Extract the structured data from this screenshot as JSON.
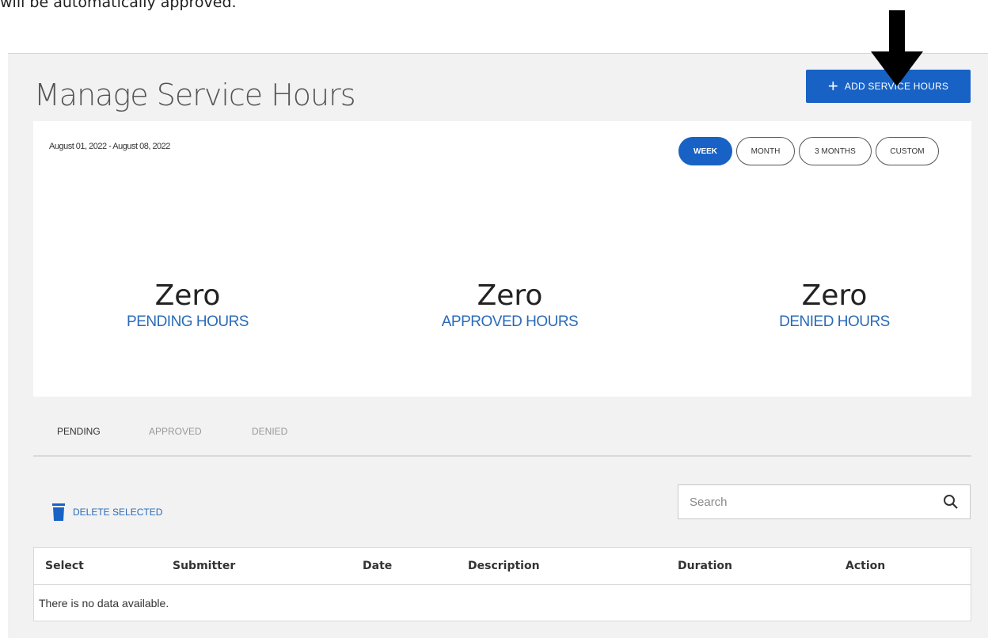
{
  "intro": {
    "text": "will be automatically approved."
  },
  "page": {
    "title": "Manage Service Hours"
  },
  "add_button": {
    "label": "ADD SERVICE HOURS",
    "icon": "plus-icon"
  },
  "summary": {
    "date_range": "August 01, 2022 - August 08, 2022",
    "range_tabs": [
      {
        "label": "WEEK",
        "active": true
      },
      {
        "label": "MONTH",
        "active": false
      },
      {
        "label": "3 MONTHS",
        "active": false
      },
      {
        "label": "CUSTOM",
        "active": false
      }
    ],
    "stats": [
      {
        "value": "Zero",
        "label": "PENDING HOURS"
      },
      {
        "value": "Zero",
        "label": "APPROVED HOURS"
      },
      {
        "value": "Zero",
        "label": "DENIED HOURS"
      }
    ]
  },
  "status_tabs": [
    {
      "label": "PENDING",
      "active": true
    },
    {
      "label": "APPROVED",
      "active": false
    },
    {
      "label": "DENIED",
      "active": false
    }
  ],
  "actions": {
    "delete_selected": "DELETE SELECTED"
  },
  "search": {
    "placeholder": "Search",
    "value": ""
  },
  "table": {
    "columns": [
      "Select",
      "Submitter",
      "Date",
      "Description",
      "Duration",
      "Action"
    ],
    "empty_message": "There is no data available."
  },
  "colors": {
    "primary": "#1862c5",
    "link": "#2a6ab8",
    "panel_bg": "#f2f2f2"
  }
}
